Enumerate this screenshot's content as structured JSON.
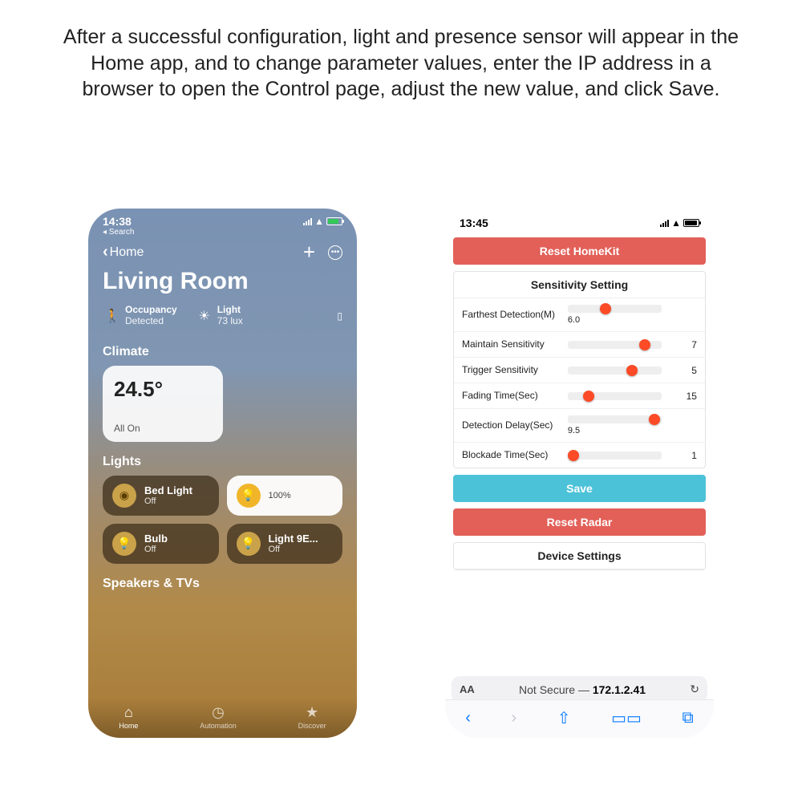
{
  "instruction": "After a successful configuration, light and presence sensor will appear in the Home app, and to change parameter values, enter the IP address in a browser to open the Control page, adjust the new value, and click Save.",
  "home_app": {
    "status_time": "14:38",
    "back_search": "◂ Search",
    "nav_back": "Home",
    "room_title": "Living Room",
    "sensors": {
      "occupancy": {
        "label": "Occupancy",
        "value": "Detected"
      },
      "light": {
        "label": "Light",
        "value": "73 lux"
      }
    },
    "climate": {
      "section": "Climate",
      "temp": "24.5°",
      "status": "All On"
    },
    "lights": {
      "section": "Lights",
      "tiles": [
        {
          "name": "Bed Light",
          "state": "Off",
          "on": false
        },
        {
          "name": "",
          "state": "100%",
          "on": true
        },
        {
          "name": "Bulb",
          "state": "Off",
          "on": false
        },
        {
          "name": "Light 9E...",
          "state": "Off",
          "on": false
        }
      ]
    },
    "speakers_section": "Speakers & TVs",
    "tabs": {
      "home": "Home",
      "automation": "Automation",
      "discover": "Discover"
    }
  },
  "control_page": {
    "status_time": "13:45",
    "reset_homekit": "Reset HomeKit",
    "sensitivity_title": "Sensitivity Setting",
    "rows": [
      {
        "label": "Farthest Detection(M)",
        "value": "6.0",
        "pos": 40
      },
      {
        "label": "Maintain Sensitivity",
        "value": "7",
        "pos": 82
      },
      {
        "label": "Trigger Sensitivity",
        "value": "5",
        "pos": 68
      },
      {
        "label": "Fading Time(Sec)",
        "value": "15",
        "pos": 22
      },
      {
        "label": "Detection Delay(Sec)",
        "value": "9.5",
        "pos": 92
      },
      {
        "label": "Blockade Time(Sec)",
        "value": "1",
        "pos": 6
      }
    ],
    "save": "Save",
    "reset_radar": "Reset Radar",
    "device_settings": "Device Settings",
    "url_aa": "AA",
    "url_notsecure": "Not Secure — ",
    "url_ip": "172.1.2.41"
  }
}
